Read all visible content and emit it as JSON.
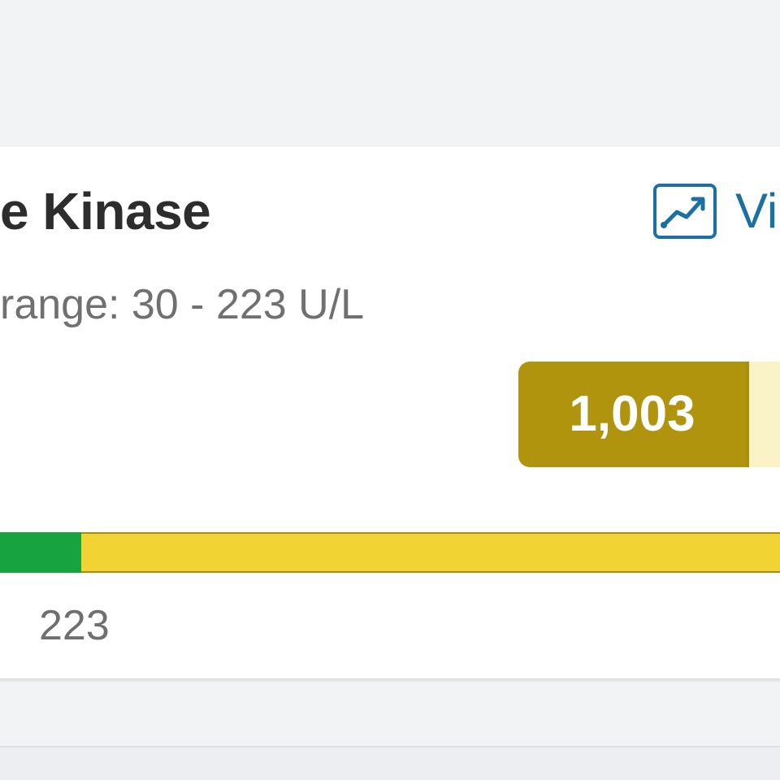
{
  "card": {
    "title": "e Kinase",
    "subtitle": "range: 30 - 223 U/L",
    "view_link": {
      "label": "Vi",
      "icon": "trend-chart-icon"
    },
    "result": {
      "value": "1,003",
      "status_color": "#b0940e",
      "flag_color": "#fbf3c8"
    },
    "range_bar": {
      "normal_color": "#17a340",
      "high_color": "#f1d334",
      "tick_label": "223"
    }
  }
}
